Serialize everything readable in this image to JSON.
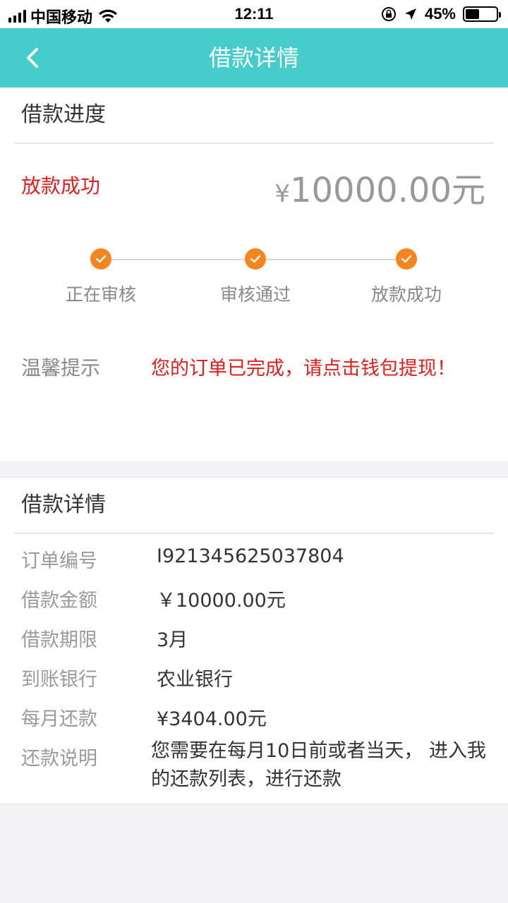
{
  "status_bar": {
    "carrier": "中国移动",
    "time": "12:11",
    "battery_percent": "45%",
    "battery_level": 0.45
  },
  "nav": {
    "title": "借款详情"
  },
  "progress": {
    "header": "借款进度",
    "status": "放款成功",
    "amount_symbol": "¥",
    "amount": "10000.00元",
    "steps": [
      {
        "label": "正在审核"
      },
      {
        "label": "审核通过"
      },
      {
        "label": "放款成功"
      }
    ],
    "tip_label": "温馨提示",
    "tip_text": "您的订单已完成，请点击钱包提现！"
  },
  "details": {
    "header": "借款详情",
    "rows": [
      {
        "label": "订单编号",
        "value": "I921345625037804"
      },
      {
        "label": "借款金额",
        "value": "￥10000.00元"
      },
      {
        "label": "借款期限",
        "value": "3月"
      },
      {
        "label": "到账银行",
        "value": "农业银行"
      },
      {
        "label": "每月还款",
        "value": "¥3404.00元"
      },
      {
        "label": "还款说明",
        "value": "您需要在每月10日前或者当天， 进入我的还款列表，进行还款"
      }
    ]
  },
  "colors": {
    "nav_bg": "#45cccb",
    "accent_red": "#e11d1d",
    "step_orange": "#f7851f"
  }
}
